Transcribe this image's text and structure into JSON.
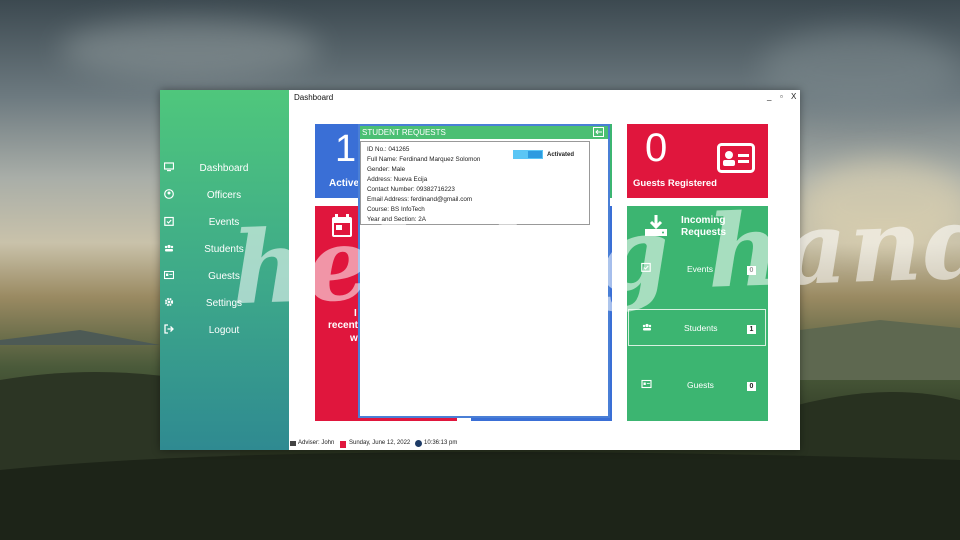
{
  "window": {
    "title": "Dashboard",
    "minimize": "_",
    "maximize": "▫",
    "close": "X"
  },
  "sidebar": {
    "items": [
      {
        "label": "Dashboard",
        "icon": "monitor-icon"
      },
      {
        "label": "Officers",
        "icon": "user-circle-icon"
      },
      {
        "label": "Events",
        "icon": "calendar-check-icon"
      },
      {
        "label": "Students",
        "icon": "users-icon"
      },
      {
        "label": "Guests",
        "icon": "id-card-icon"
      },
      {
        "label": "Settings",
        "icon": "gear-icon"
      },
      {
        "label": "Logout",
        "icon": "logout-icon"
      }
    ]
  },
  "cards": {
    "active": {
      "value": "1",
      "label": "Active",
      "color": "#3a6fd6"
    },
    "guests_registered": {
      "value": "0",
      "label": "Guests Registered",
      "color": "#e0163d"
    },
    "red_event": {
      "line1": "I",
      "line2": "recent",
      "line3": "w",
      "color": "#e0163d"
    },
    "blue_card": {
      "tail": "g",
      "color": "#3a6fd6"
    }
  },
  "incoming": {
    "title_line1": "Incoming",
    "title_line2": "Requests",
    "rows": [
      {
        "label": "Events",
        "count": "0"
      },
      {
        "label": "Students",
        "count": "1"
      },
      {
        "label": "Guests",
        "count": "0"
      }
    ],
    "color": "#3cb571"
  },
  "popup": {
    "title": "STUDENT REQUESTS",
    "status": "Activated",
    "fields": [
      "ID No.: 041265",
      "Full Name: Ferdinand Marquez Solomon",
      "Gender: Male",
      "Address: Nueva Ecija",
      "Contact Number: 09382716223",
      "Email Address: ferdinand@gmail.com",
      "Course: BS InfoTech",
      "Year and Section: 2A"
    ]
  },
  "status_bar": {
    "adviser": "Adviser: John",
    "date": "Sunday, June 12, 2022",
    "time": "10:36:13 pm"
  },
  "watermark": "helping hand"
}
